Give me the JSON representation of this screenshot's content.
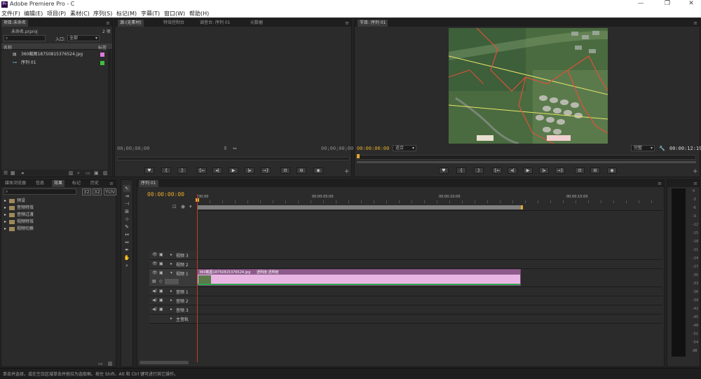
{
  "window": {
    "title": "Adobe Premiere Pro - C",
    "controls": [
      "—",
      "❐",
      "✕"
    ]
  },
  "menu": [
    "文件(F)",
    "编辑(E)",
    "项目(P)",
    "素材(C)",
    "序列(S)",
    "标记(M)",
    "字幕(T)",
    "窗口(W)",
    "帮助(H)"
  ],
  "project": {
    "tab": "项目:未命名",
    "file": "未命名.prproj",
    "count": "2 项",
    "search_placeholder": "",
    "entry_label": "入口:",
    "entry_value": "全部",
    "col_name": "名称",
    "col_label": "标签",
    "items": [
      {
        "name": "360截图18750815376524.jpg",
        "color": "#e07ae0"
      },
      {
        "name": "序列 01",
        "color": "#3fbf3f"
      }
    ]
  },
  "source": {
    "tabs": [
      "源:(无素材)",
      "特效控制台",
      "调音台: 序列 01",
      "元数据"
    ],
    "tc_left": "00;00;00;00",
    "tc_right": "00;00;00;00"
  },
  "program": {
    "tab": "节目: 序列 01",
    "tc_left": "00:00:00:00",
    "fit": "适合",
    "quality": "完整",
    "tc_right": "00:00:12:19"
  },
  "effects": {
    "tabs": [
      "媒体浏览器",
      "信息",
      "效果",
      "标记",
      "历史"
    ],
    "folders": [
      "预设",
      "音频特效",
      "音频过渡",
      "视频特效",
      "视频切换"
    ]
  },
  "timeline": {
    "tab": "序列 01",
    "tc": "00:00:00:00",
    "ruler": [
      "00:00",
      "00:00:05:00",
      "00:00:10:00",
      "00:00:15:00"
    ],
    "video_tracks": [
      "视频 3",
      "视频 2",
      "视频 1"
    ],
    "audio_tracks": [
      "音频 1",
      "音频 2",
      "音频 3"
    ],
    "master": "主音轨",
    "clip_name": "360截图18750815376524.jpg",
    "clip_fx": "透明度:透明度"
  },
  "meter_ticks": [
    "0",
    "-3",
    "-6",
    "-9",
    "-12",
    "-15",
    "-18",
    "-21",
    "-24",
    "-27",
    "-30",
    "-33",
    "-36",
    "-39",
    "-42",
    "-45",
    "-48",
    "-51",
    "-54",
    "dB"
  ],
  "status": "单击并选择，或在空白区域单击并拖拉为选取框。按住 Shift、Alt 和 Ctrl 键可进行其它操作。"
}
